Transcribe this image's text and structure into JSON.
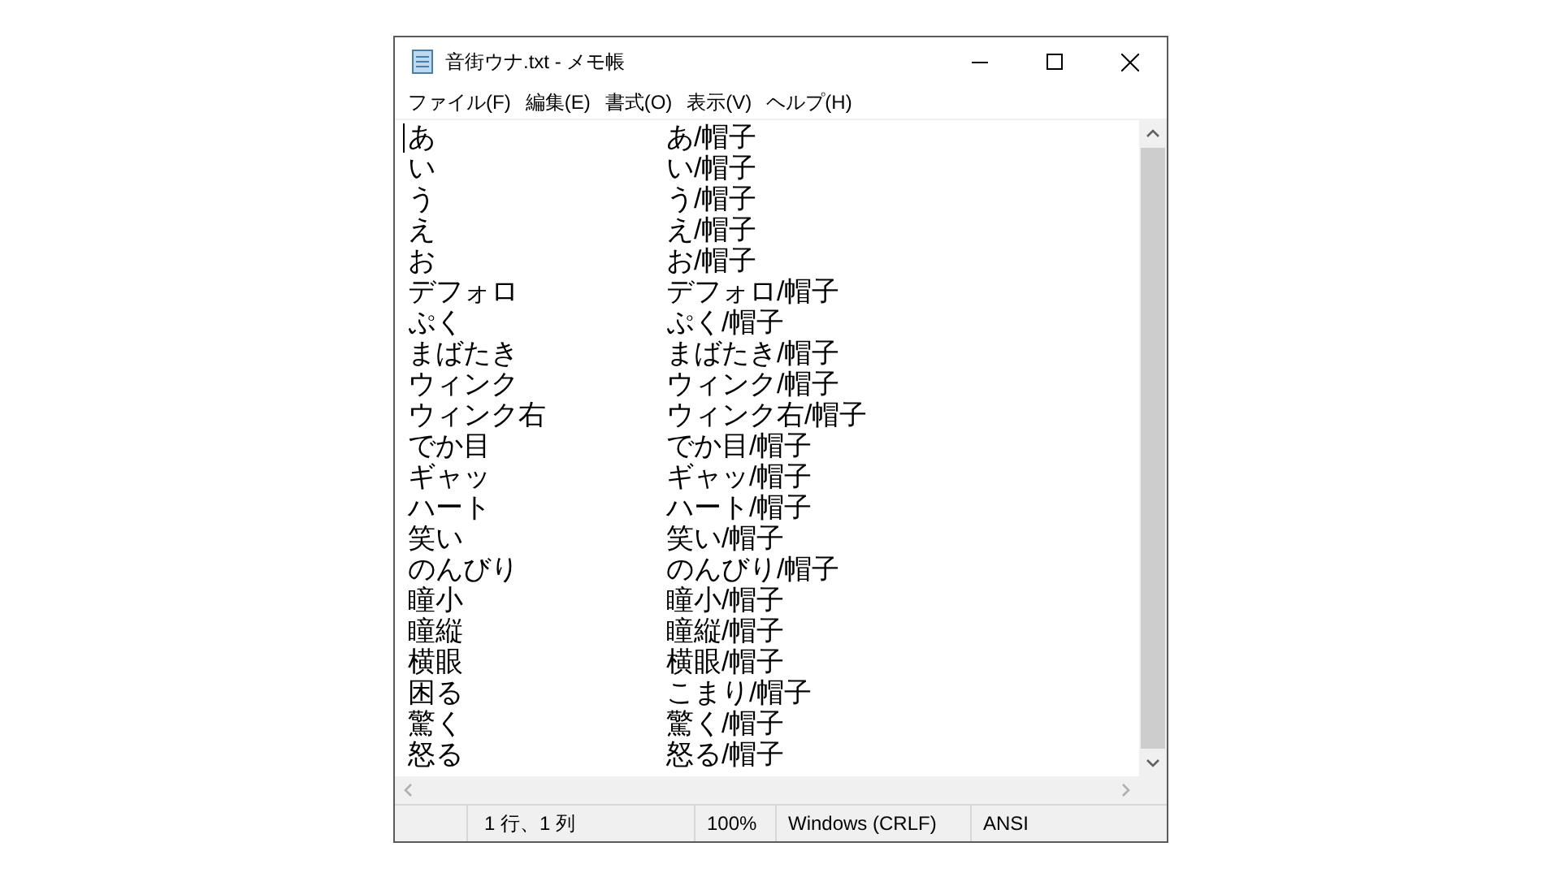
{
  "window": {
    "title": "音街ウナ.txt - メモ帳"
  },
  "menu": [
    "ファイル(F)",
    "編集(E)",
    "書式(O)",
    "表示(V)",
    "ヘルプ(H)"
  ],
  "lines": [
    {
      "column_1": "あ",
      "column_2": "あ/帽子"
    },
    {
      "column_1": "い",
      "column_2": "い/帽子"
    },
    {
      "column_1": "う",
      "column_2": "う/帽子"
    },
    {
      "column_1": "え",
      "column_2": "え/帽子"
    },
    {
      "column_1": "お",
      "column_2": "お/帽子"
    },
    {
      "column_1": "デフォロ",
      "column_2": "デフォロ/帽子"
    },
    {
      "column_1": "ぷく",
      "column_2": "ぷく/帽子"
    },
    {
      "column_1": "まばたき",
      "column_2": "まばたき/帽子"
    },
    {
      "column_1": "ウィンク",
      "column_2": "ウィンク/帽子"
    },
    {
      "column_1": "ウィンク右",
      "column_2": "ウィンク右/帽子"
    },
    {
      "column_1": "でか目",
      "column_2": "でか目/帽子"
    },
    {
      "column_1": "ギャッ",
      "column_2": "ギャッ/帽子"
    },
    {
      "column_1": "ハート",
      "column_2": "ハート/帽子"
    },
    {
      "column_1": "笑い",
      "column_2": "笑い/帽子"
    },
    {
      "column_1": "のんびり",
      "column_2": "のんびり/帽子"
    },
    {
      "column_1": "瞳小",
      "column_2": "瞳小/帽子"
    },
    {
      "column_1": "瞳縦",
      "column_2": "瞳縦/帽子"
    },
    {
      "column_1": "横眼",
      "column_2": "横眼/帽子"
    },
    {
      "column_1": "困る",
      "column_2": "こまり/帽子"
    },
    {
      "column_1": "驚く",
      "column_2": "驚く/帽子"
    },
    {
      "column_1": "怒る",
      "column_2": "怒る/帽子"
    }
  ],
  "status_bar": {
    "position": "1 行、1 列",
    "zoom": "100%",
    "line_ending": "Windows (CRLF)",
    "encoding": "ANSI"
  }
}
